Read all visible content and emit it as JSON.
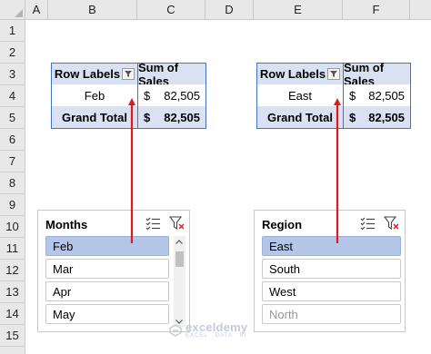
{
  "sheet": {
    "columns": [
      "A",
      "B",
      "C",
      "D",
      "E",
      "F"
    ],
    "rows": [
      "1",
      "2",
      "3",
      "4",
      "5",
      "6",
      "7",
      "8",
      "9",
      "10",
      "11",
      "12",
      "13",
      "14",
      "15"
    ]
  },
  "pivot_months": {
    "header_labels": "Row Labels",
    "header_sum": "Sum of Sales",
    "row_label": "Feb",
    "row_currency": "$",
    "row_value": "82,505",
    "total_label": "Grand Total",
    "total_currency": "$",
    "total_value": "82,505"
  },
  "pivot_region": {
    "header_labels": "Row Labels",
    "header_sum": "Sum of Sales",
    "row_label": "East",
    "row_currency": "$",
    "row_value": "82,505",
    "total_label": "Grand Total",
    "total_currency": "$",
    "total_value": "82,505"
  },
  "slicer_months": {
    "title": "Months",
    "items": [
      {
        "label": "Feb",
        "state": "selected"
      },
      {
        "label": "Mar",
        "state": "normal"
      },
      {
        "label": "Apr",
        "state": "normal"
      },
      {
        "label": "May",
        "state": "normal"
      }
    ]
  },
  "slicer_region": {
    "title": "Region",
    "items": [
      {
        "label": "East",
        "state": "selected"
      },
      {
        "label": "South",
        "state": "normal"
      },
      {
        "label": "West",
        "state": "normal"
      },
      {
        "label": "North",
        "state": "nodata"
      }
    ]
  },
  "watermark": {
    "name": "exceldemy",
    "tagline": "EXCEL · DATA · BI"
  },
  "colors": {
    "header_fill": "#d9e1f2",
    "table_border": "#4472c4",
    "slicer_selected": "#b4c6e7",
    "arrow": "#e0191f"
  }
}
